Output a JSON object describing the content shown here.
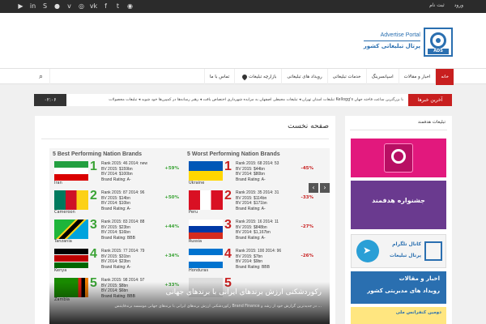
{
  "topbar": {
    "login": "ورود",
    "register": "ثبت نام",
    "social_icons": [
      "youtube-icon",
      "linkedin-icon",
      "skype-icon",
      "flickr-icon",
      "vimeo-icon",
      "dribbble-icon",
      "vk-icon",
      "facebook-icon",
      "twitter-icon",
      "rss-icon"
    ],
    "social_glyphs": [
      "▶",
      "in",
      "S",
      "●",
      "v",
      "◎",
      "vk",
      "f",
      "t",
      "◉"
    ]
  },
  "logo": {
    "brand_en": "Advertise Portal",
    "brand_fa": "پرتال تبلیغاتی کشور",
    "badge": "ADS"
  },
  "nav": {
    "items": [
      "خانه",
      "اخبار و مقالات",
      "اسپانسرینگ",
      "خدمات تبلیغاتی",
      "رویداد های تبلیغاتی",
      "بازارچه تبلیغات",
      "تماس با ما"
    ],
    "search_glyph": "⌕"
  },
  "ticker": {
    "label": "آخرین خبرها",
    "text": "تبلیغات استان تهران  ◂  تبلیغات محیطی اصفهان به مزایده شهرداری اختصاص یافت  ◂  رهبر رسانه‌ها در کمپین‌ها خود شوید  ◂  تبلیغات محصولات Kellogg's با بزرگترین ساعت فاخته جهان",
    "time": "۰۲:۰۶"
  },
  "main": {
    "title": "صفحه نخست",
    "best_title": "5 Best Performing Nation Brands",
    "worst_title": "5 Worst Performing Nation Brands",
    "best": [
      {
        "rank": "1",
        "country": "Iran",
        "r2015": "Rank 2015: 46  2014: new",
        "bv2015": "BV 2015: $159bn",
        "bv2014": "BV 2014: $100bn",
        "rating": "Brand Rating: A-",
        "change": "+59%"
      },
      {
        "rank": "2",
        "country": "Cameroon",
        "r2015": "Rank 2015: 87  2014: 96",
        "bv2015": "BV 2015: $14bn",
        "bv2014": "BV 2014: $10bn",
        "rating": "Brand Rating: A-",
        "change": "+50%"
      },
      {
        "rank": "3",
        "country": "Tanzania",
        "r2015": "Rank 2015: 83  2014: 88",
        "bv2015": "BV 2015: $23bn",
        "bv2014": "BV 2014: $16bn",
        "rating": "Brand Rating: BBB",
        "change": "+44%"
      },
      {
        "rank": "4",
        "country": "Kenya",
        "r2015": "Rank 2015: 77  2014: 79",
        "bv2015": "BV 2015: $31bn",
        "bv2014": "BV 2014: $23bn",
        "rating": "Brand Rating: A-",
        "change": "+34%"
      },
      {
        "rank": "5",
        "country": "Zambia",
        "r2015": "Rank 2015: 98  2014: 97",
        "bv2015": "BV 2015: $8bn",
        "bv2014": "BV 2014: $6bn",
        "rating": "Brand Rating: BBB",
        "change": "+33%"
      }
    ],
    "worst": [
      {
        "rank": "1",
        "country": "Ukraine",
        "r2015": "Rank 2015: 68  2014: 53",
        "bv2015": "BV 2015: $44bn",
        "bv2014": "BV 2014: $80bn",
        "rating": "Brand Rating: A-",
        "change": "-45%"
      },
      {
        "rank": "2",
        "country": "Peru",
        "r2015": "Rank 2015: 35  2014: 31",
        "bv2015": "BV 2015: $114bn",
        "bv2014": "BV 2014: $171bn",
        "rating": "Brand Rating: A-",
        "change": "-33%"
      },
      {
        "rank": "3",
        "country": "Russia",
        "r2015": "Rank 2015: 16  2014: 11",
        "bv2015": "BV 2015: $848bn",
        "bv2014": "BV 2014: $1,167bn",
        "rating": "Brand Rating: A-",
        "change": "-27%"
      },
      {
        "rank": "4",
        "country": "Honduras",
        "r2015": "Rank 2015: 100  2014: 96",
        "bv2015": "BV 2015: $7bn",
        "bv2014": "BV 2014: $9bn",
        "rating": "Brand Rating: BBB",
        "change": "-26%"
      },
      {
        "rank": "5",
        "country": "",
        "r2015": "",
        "bv2015": "",
        "bv2014": "",
        "rating": "",
        "change": ""
      }
    ],
    "caption_title": "رکوردشکنی ارزش برند‌های ایرانی با برند‌های جهانی",
    "caption_text": "رکوردشکنی ارزش برند‌های ایرانی با برند‌های جهانی موسسه برندفایننس Brand Finance در جدیدترین گزارش خود از رشد و ...",
    "prev_glyph": "‹",
    "next_glyph": "›"
  },
  "sidebar": {
    "title": "تبلیغات هدفمند",
    "ad2_text": "جشنواره هدفمند",
    "ad3_line1": "کانال تلگرام",
    "ad3_line2": "پرتال تبلیغات",
    "ad4_line1": "اخبار و مقالات",
    "ad4_line2": "رویداد های مدیریتی کشور",
    "ad5_text": "دومین کنفرانس ملی"
  }
}
